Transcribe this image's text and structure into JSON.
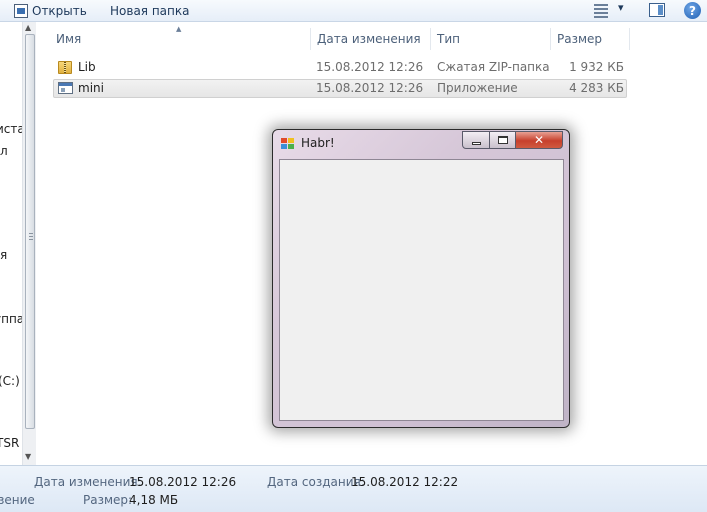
{
  "toolbar": {
    "open_label": "Открыть",
    "new_folder_label": "Новая папка",
    "help_glyph": "?"
  },
  "nav": {
    "items": [
      "иста",
      "л",
      "я",
      "уппа",
      "(C:)",
      "TSR"
    ]
  },
  "columns": {
    "name": "Имя",
    "modified": "Дата изменения",
    "type": "Тип",
    "size": "Размер"
  },
  "files": [
    {
      "name": "Lib",
      "modified": "15.08.2012 12:26",
      "type": "Сжатая ZIP-папка",
      "size": "1 932 КБ",
      "icon": "zip-folder-icon"
    },
    {
      "name": "mini",
      "modified": "15.08.2012 12:26",
      "type": "Приложение",
      "size": "4 283 КБ",
      "icon": "application-icon"
    }
  ],
  "window": {
    "title": "Habr!",
    "close_glyph": "✕"
  },
  "details": {
    "modified_label": "Дата изменения:",
    "modified_value": "15.08.2012 12:26",
    "created_label": "Дата создания:",
    "created_value": "15.08.2012 12:22",
    "partial_label": "зение",
    "size_label": "Размер:",
    "size_value": "4,18 МБ"
  }
}
